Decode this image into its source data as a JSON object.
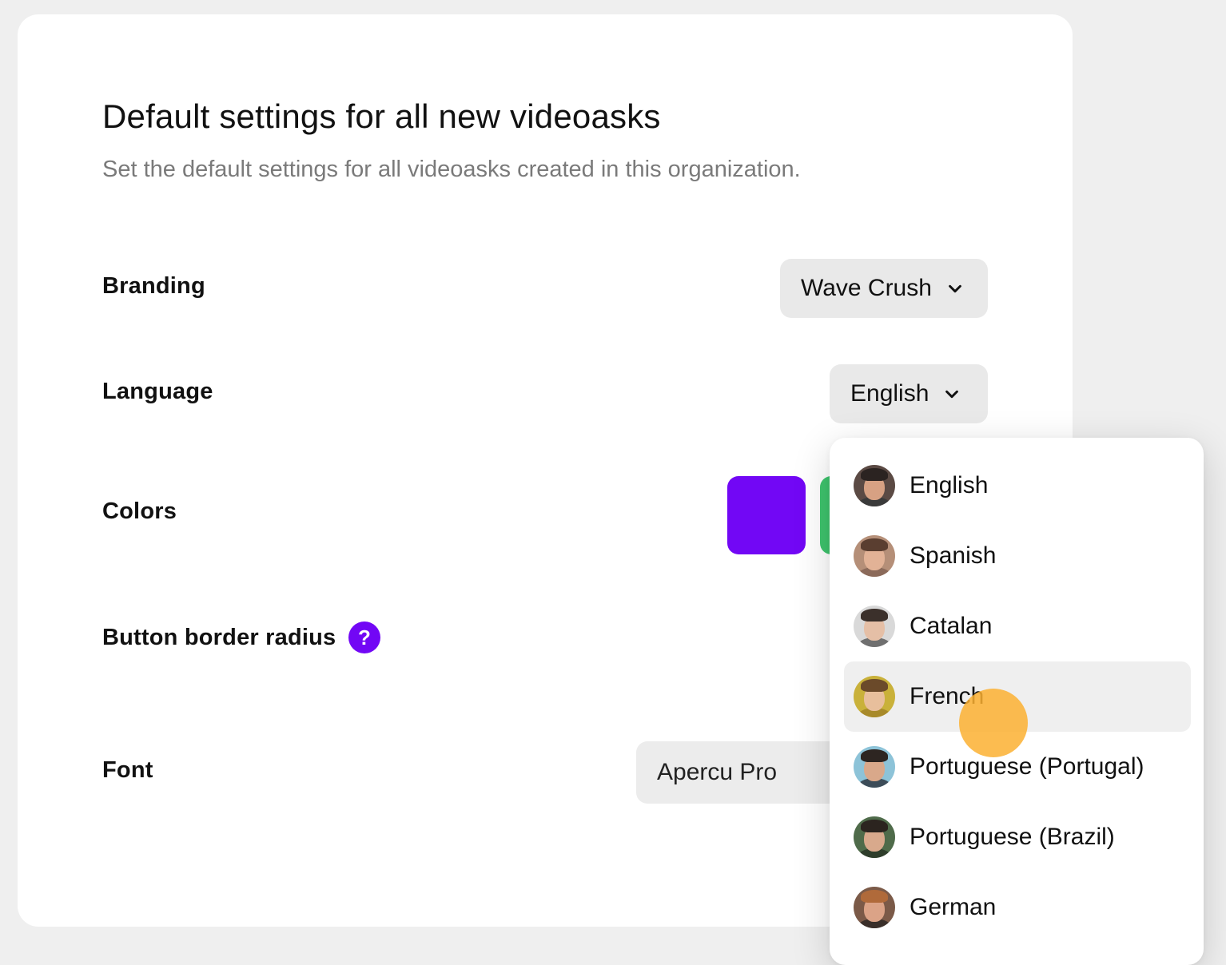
{
  "header": {
    "title": "Default settings for all new videoasks",
    "subtitle": "Set the default settings for all videoasks created in this organization."
  },
  "settings": {
    "branding": {
      "label": "Branding",
      "value": "Wave Crush"
    },
    "language": {
      "label": "Language",
      "value": "English"
    },
    "colors": {
      "label": "Colors",
      "swatches": [
        "#7207f5",
        "#3ec46d"
      ]
    },
    "button_radius": {
      "label": "Button border radius",
      "help_icon": "question-mark-icon",
      "help_glyph": "?"
    },
    "font": {
      "label": "Font",
      "value": "Apercu Pro"
    }
  },
  "language_menu": {
    "items": [
      {
        "label": "English",
        "selected": false,
        "avatar": {
          "bg": "#5b4a44",
          "skin": "#d7a183",
          "hair": "#2b2321",
          "shirt": "#3a3a3a"
        }
      },
      {
        "label": "Spanish",
        "selected": false,
        "avatar": {
          "bg": "#b58f78",
          "skin": "#e2b296",
          "hair": "#5a3e30",
          "shirt": "#8b6a5a"
        }
      },
      {
        "label": "Catalan",
        "selected": false,
        "avatar": {
          "bg": "#d9d9d9",
          "skin": "#e5bfa6",
          "hair": "#3b302b",
          "shirt": "#6f6f6f"
        }
      },
      {
        "label": "French",
        "selected": true,
        "avatar": {
          "bg": "#c9b13a",
          "skin": "#e8bf9c",
          "hair": "#6b4a2a",
          "shirt": "#a88a2a"
        }
      },
      {
        "label": "Portuguese (Portugal)",
        "selected": false,
        "avatar": {
          "bg": "#8dc3d8",
          "skin": "#d9a88a",
          "hair": "#2d2521",
          "shirt": "#3c4c58"
        }
      },
      {
        "label": "Portuguese (Brazil)",
        "selected": false,
        "avatar": {
          "bg": "#4f6b4a",
          "skin": "#d8a98c",
          "hair": "#2b241f",
          "shirt": "#2e3d2b"
        }
      },
      {
        "label": "German",
        "selected": false,
        "avatar": {
          "bg": "#7b5a48",
          "skin": "#dba387",
          "hair": "#b06a3a",
          "shirt": "#3a2f2a"
        }
      }
    ]
  },
  "colors": {
    "accent": "#7207f5",
    "cursor_highlight": "#fbb031",
    "chevron": "#111111"
  }
}
